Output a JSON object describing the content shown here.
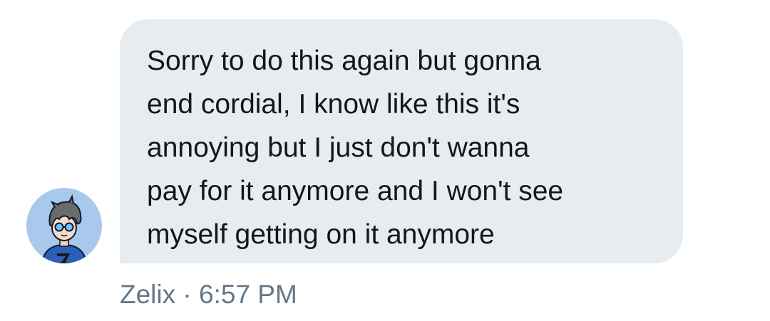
{
  "message": {
    "text": "Sorry to do this again but gonna\nend cordial, I know like this it's\nannoying but I just don't wanna\npay for it anymore and I won't see\nmyself getting on it anymore",
    "sender": "Zelix",
    "separator": " · ",
    "time": "6:57 PM"
  },
  "avatar": {
    "icon": "user-avatar-icon",
    "background": "#a9c9ec"
  },
  "colors": {
    "bubble": "#e6ecf0",
    "text": "#14171a",
    "meta": "#657786"
  }
}
